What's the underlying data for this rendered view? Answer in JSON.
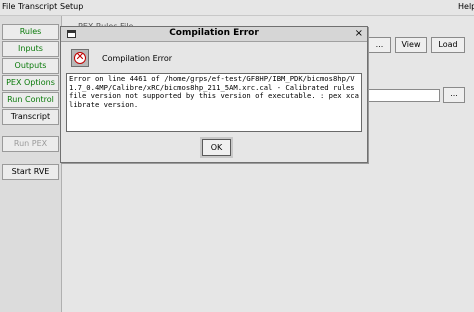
{
  "menubar": {
    "items": [
      "File",
      "Transcript",
      "Setup"
    ],
    "help": "Help"
  },
  "sidebar": {
    "items": [
      {
        "label": "Rules"
      },
      {
        "label": "Inputs"
      },
      {
        "label": "Outputs"
      },
      {
        "label": "PEX Options"
      },
      {
        "label": "Run Control"
      },
      {
        "label": "Transcript"
      },
      {
        "label": "Run PEX"
      },
      {
        "label": "Start RVE"
      }
    ]
  },
  "background": {
    "rules_file_label": "PEX Rules File",
    "view_label": "View",
    "load_label": "Load",
    "browse_label": "..."
  },
  "dialog": {
    "title": "Compilation Error",
    "close_label": "×",
    "header_text": "Compilation Error",
    "message": "Error on line 4461 of /home/grps/ef-test/GF8HP/IBM_PDK/bicmos8hp/V1.7_0.4MP/Calibre/xRC/bicmos8hp_211_5AM.xrc.cal - Calibrated rules file version not supported by this version of executable. : pex xcalibrate version.",
    "ok_label": "OK"
  }
}
